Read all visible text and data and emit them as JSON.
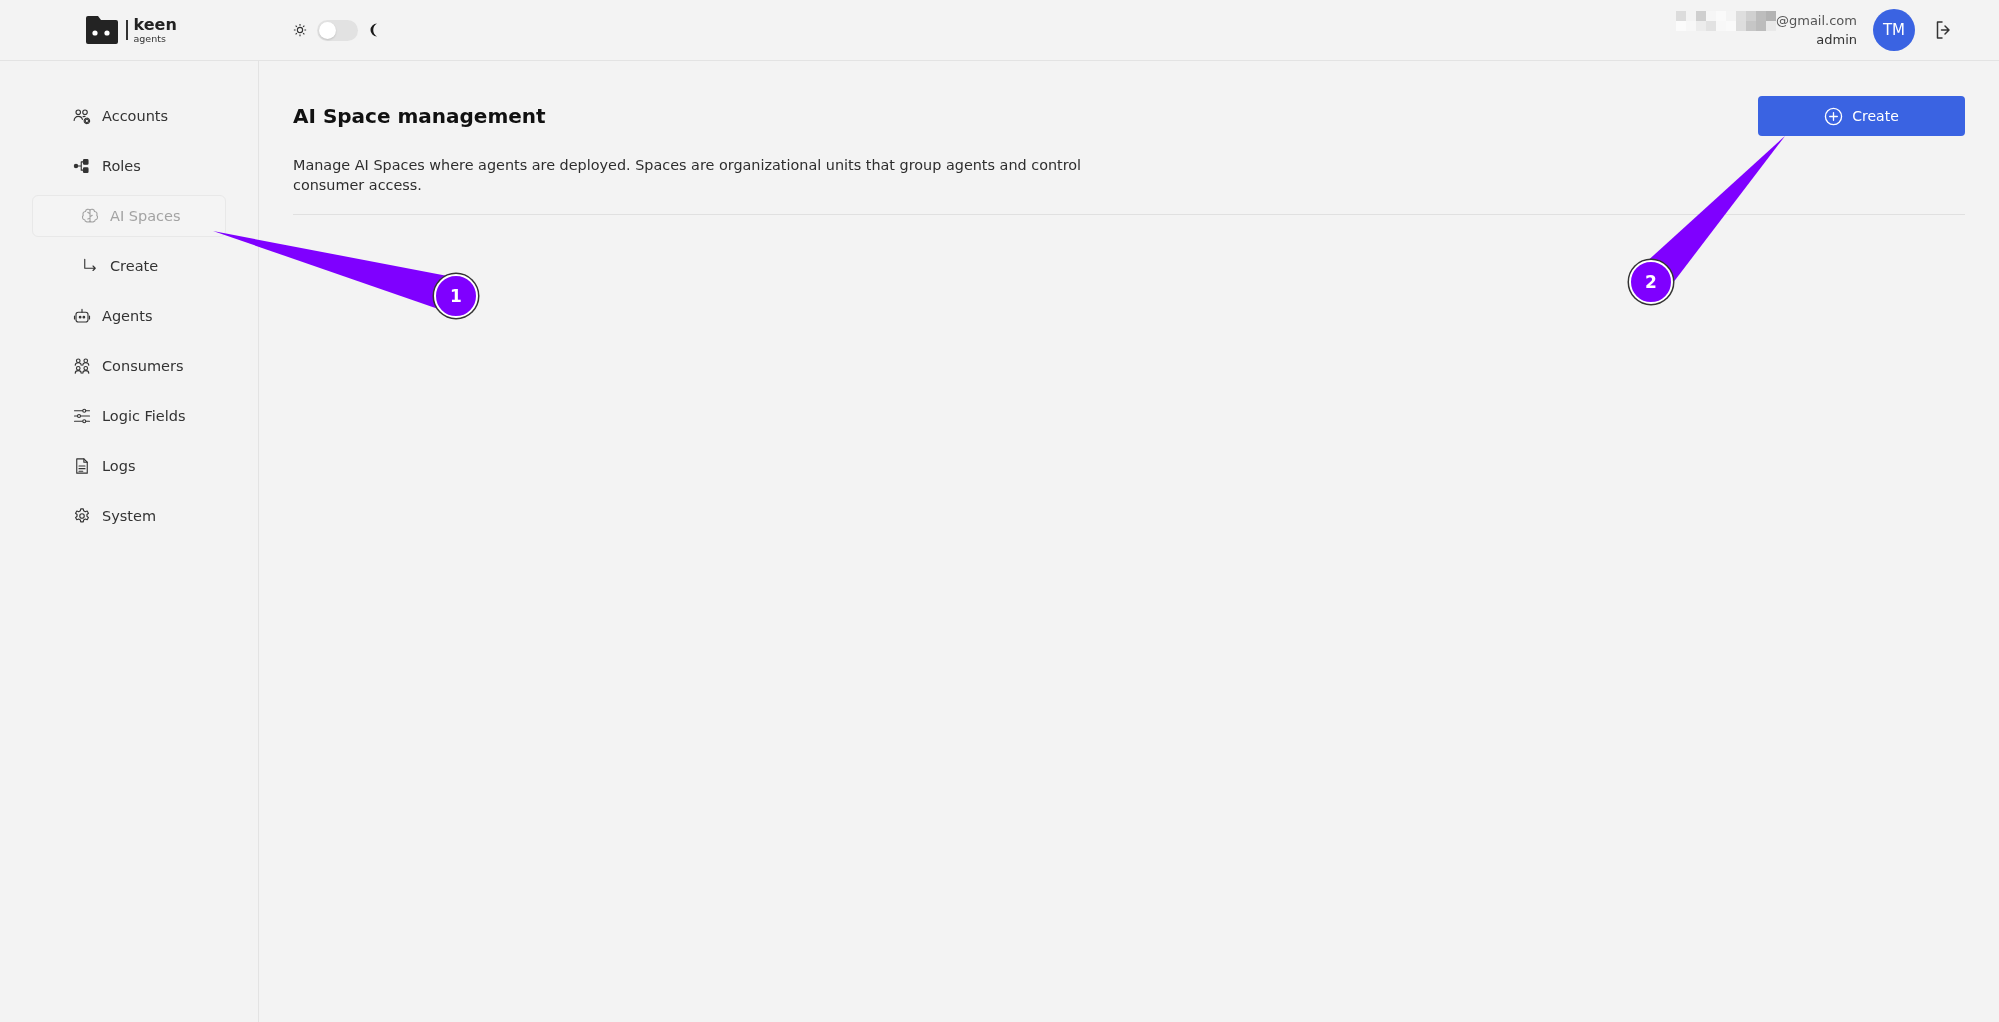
{
  "header": {
    "logo": {
      "name": "keen",
      "tagline": "agents"
    },
    "theme_toggle": {
      "on": false
    },
    "user": {
      "email": "@gmail.com",
      "role": "admin",
      "initials": "TM"
    }
  },
  "sidebar": {
    "items": [
      {
        "label": "Accounts",
        "selected": false
      },
      {
        "label": "Roles",
        "selected": false
      },
      {
        "label": "AI Spaces",
        "selected": true,
        "children": [
          {
            "label": "Create",
            "selected": false
          }
        ]
      },
      {
        "label": "Agents",
        "selected": false
      },
      {
        "label": "Consumers",
        "selected": false
      },
      {
        "label": "Logic Fields",
        "selected": false
      },
      {
        "label": "Logs",
        "selected": false
      },
      {
        "label": "System",
        "selected": false
      }
    ]
  },
  "page": {
    "title": "AI Space management",
    "description": "Manage AI Spaces where agents are deployed. Spaces are organizational units that group agents and control consumer access.",
    "create_button": {
      "label": "Create"
    }
  },
  "annotations": [
    {
      "label": "1"
    },
    {
      "label": "2"
    }
  ]
}
